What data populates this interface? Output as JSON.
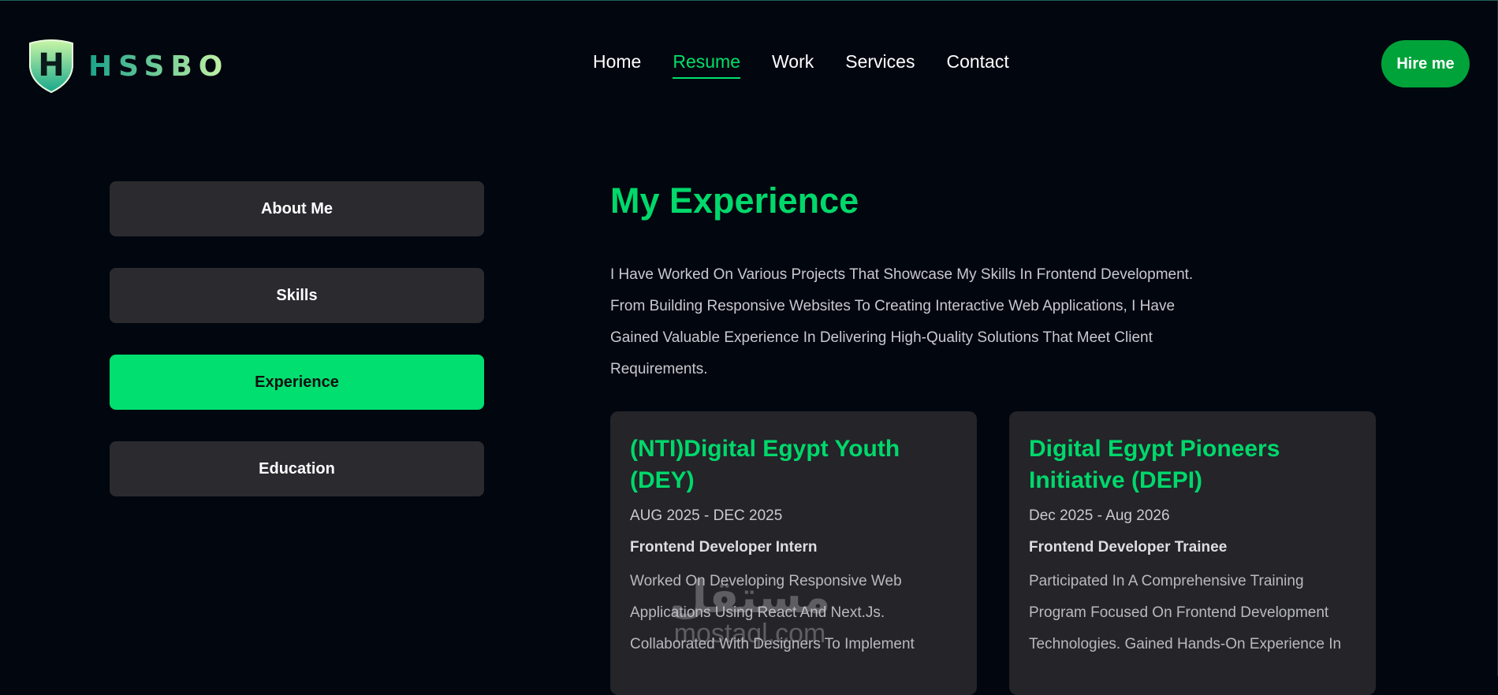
{
  "header": {
    "logo_letter": "H",
    "logo_text": "HSSBO",
    "nav": [
      {
        "label": "Home",
        "active": false
      },
      {
        "label": "Resume",
        "active": true
      },
      {
        "label": "Work",
        "active": false
      },
      {
        "label": "Services",
        "active": false
      },
      {
        "label": "Contact",
        "active": false
      }
    ],
    "hire_label": "Hire me"
  },
  "tabs": [
    {
      "label": "About Me",
      "active": false
    },
    {
      "label": "Skills",
      "active": false
    },
    {
      "label": "Experience",
      "active": true
    },
    {
      "label": "Education",
      "active": false
    }
  ],
  "main": {
    "title": "My Experience",
    "description": "I Have Worked On Various Projects That Showcase My Skills In Frontend Development. From Building Responsive Websites To Creating Interactive Web Applications, I Have Gained Valuable Experience In Delivering High-Quality Solutions That Meet Client Requirements.",
    "cards": [
      {
        "title": "(NTI)Digital Egypt Youth (DEY)",
        "date": "AUG 2025 - DEC 2025",
        "role": "Frontend Developer Intern",
        "text": "Worked On Developing Responsive Web Applications Using React And Next.Js. Collaborated With Designers To Implement"
      },
      {
        "title": "Digital Egypt Pioneers Initiative (DEPI)",
        "date": "Dec 2025 - Aug 2026",
        "role": "Frontend Developer Trainee",
        "text": "Participated In A Comprehensive Training Program Focused On Frontend Development Technologies. Gained Hands-On Experience In"
      }
    ]
  },
  "watermark": {
    "arabic": "مستقل",
    "latin": "mostaql.com"
  },
  "colors": {
    "accent": "#00df6f",
    "background": "#02060f",
    "card": "#242429",
    "tab": "#2a2a2f",
    "hire": "#00a33a"
  }
}
